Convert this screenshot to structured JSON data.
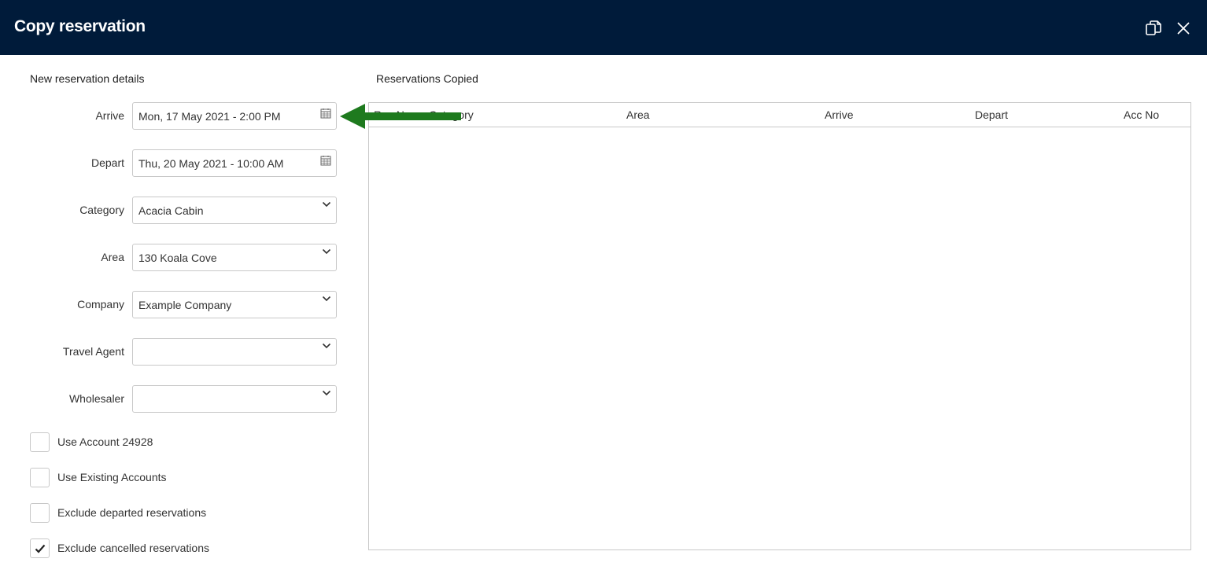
{
  "window": {
    "title": "Copy reservation"
  },
  "form": {
    "heading": "New reservation details",
    "fields": [
      {
        "label": "Arrive",
        "value": "Mon, 17 May 2021 - 2:00 PM",
        "icon": "calendar-icon"
      },
      {
        "label": "Depart",
        "value": "Thu, 20 May 2021 - 10:00 AM",
        "icon": "calendar-icon"
      },
      {
        "label": "Category",
        "value": "Acacia Cabin",
        "icon": "chevron-down-icon"
      },
      {
        "label": "Area",
        "value": "130 Koala Cove",
        "icon": "chevron-down-icon"
      },
      {
        "label": "Company",
        "value": "Example Company",
        "icon": "chevron-down-icon"
      },
      {
        "label": "Travel Agent",
        "value": "",
        "icon": "chevron-down-icon"
      },
      {
        "label": "Wholesaler",
        "value": "",
        "icon": "chevron-down-icon"
      }
    ],
    "checkboxes": [
      {
        "label": "Use Account 24928",
        "checked": false
      },
      {
        "label": "Use Existing Accounts",
        "checked": false
      },
      {
        "label": "Exclude departed reservations",
        "checked": false
      },
      {
        "label": "Exclude cancelled reservations",
        "checked": true
      }
    ]
  },
  "copied": {
    "heading": "Reservations Copied",
    "columns": [
      "Res No",
      "Category",
      "Area",
      "Arrive",
      "Depart",
      "Acc No"
    ]
  },
  "annotation": {
    "arrow_color": "#1e7a1e"
  }
}
